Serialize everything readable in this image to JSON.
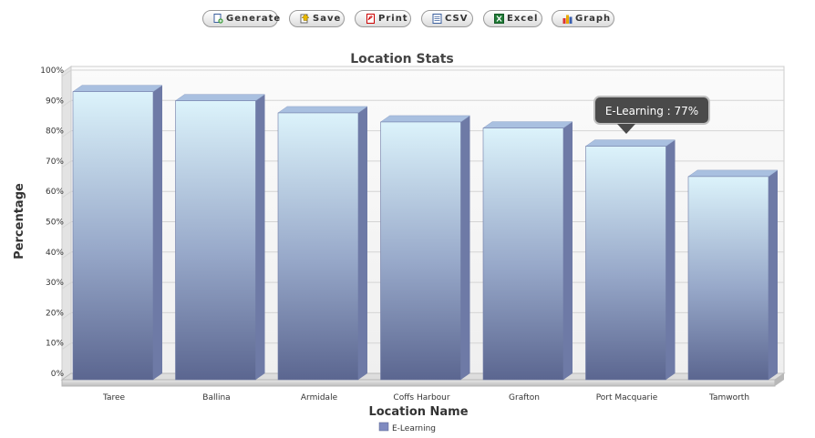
{
  "toolbar": {
    "buttons": [
      {
        "label": "Generate",
        "icon": "generate-icon"
      },
      {
        "label": "Save",
        "icon": "save-icon"
      },
      {
        "label": "Print",
        "icon": "print-icon"
      },
      {
        "label": "CSV",
        "icon": "csv-icon"
      },
      {
        "label": "Excel",
        "icon": "excel-icon"
      },
      {
        "label": "Graph",
        "icon": "graph-icon"
      }
    ]
  },
  "tooltip": {
    "text": "E-Learning : 77%"
  },
  "colors": {
    "bar_top": "#dcf3fb",
    "bar_bottom": "#5b6690",
    "bar_side": "#6e7aa6",
    "legend_swatch": "#7f8ac0"
  },
  "chart_data": {
    "type": "bar",
    "title": "Location Stats",
    "xlabel": "Location Name",
    "ylabel": "Percentage",
    "categories": [
      "Taree",
      "Ballina",
      "Armidale",
      "Coffs Harbour",
      "Grafton",
      "Port Macquarie",
      "Tamworth"
    ],
    "series": [
      {
        "name": "E-Learning",
        "values": [
          95,
          92,
          88,
          85,
          83,
          77,
          67
        ]
      }
    ],
    "ylim": [
      0,
      100
    ],
    "yticks": [
      "0%",
      "10%",
      "20%",
      "30%",
      "40%",
      "50%",
      "60%",
      "70%",
      "80%",
      "90%",
      "100%"
    ],
    "grid": true,
    "legend": "bottom-center",
    "three_d": true
  }
}
